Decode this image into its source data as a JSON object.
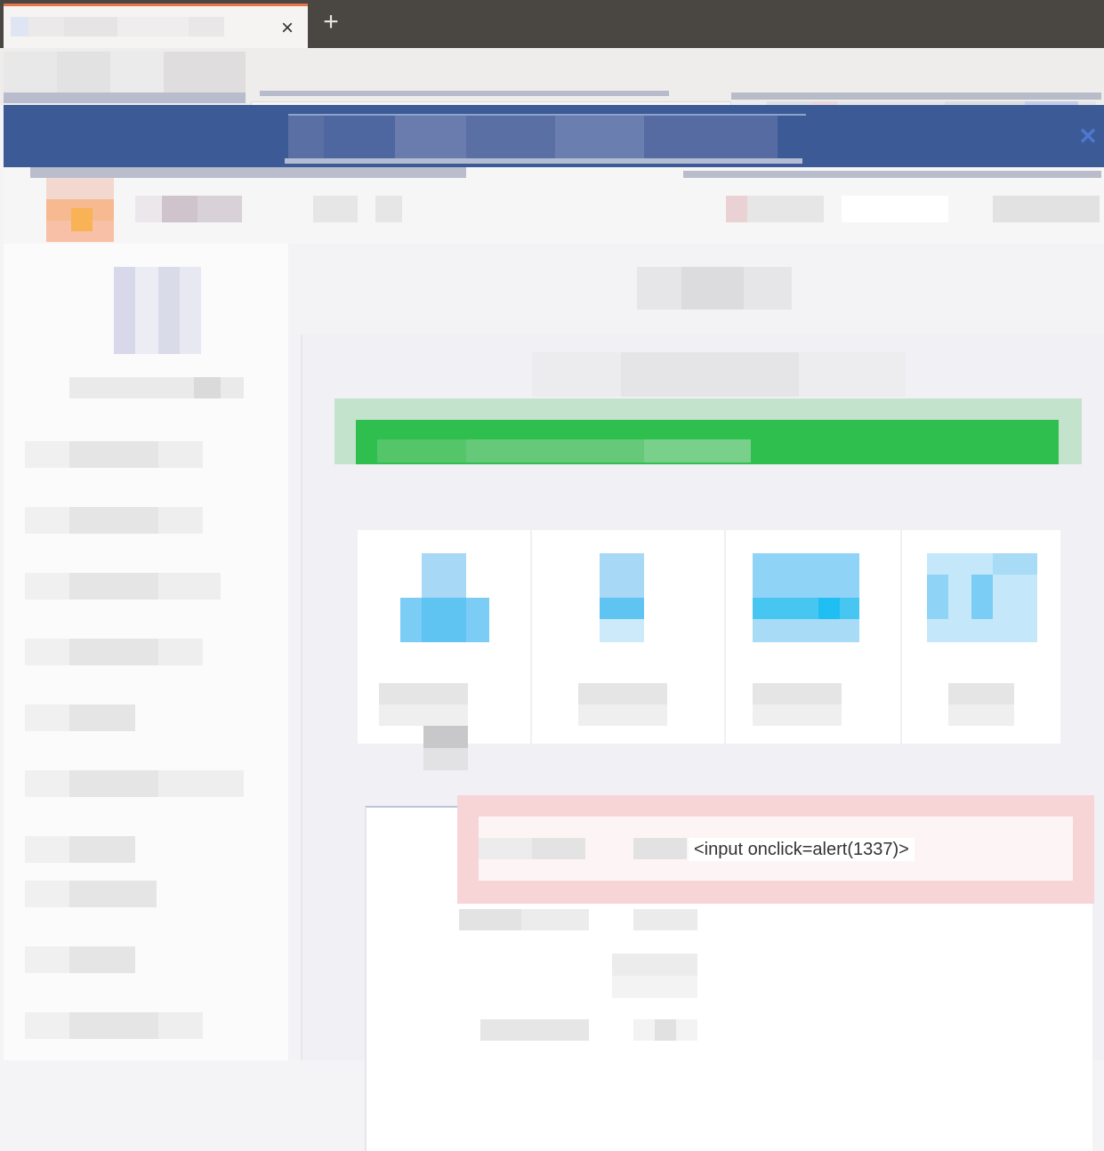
{
  "browser": {
    "tab_close_glyph": "×",
    "new_tab_glyph": "+",
    "url_first_char": "(",
    "menu_glyph": "⋮"
  },
  "banner": {
    "close_glyph": "✕"
  },
  "details": {
    "injected_value": "<input onclick=alert(1337)>"
  },
  "colors": {
    "banner": "#3c5a95",
    "alert_green": "#2ebf4f",
    "highlight_red": "#f7d5d7",
    "icon_blue": "#5fc4f1"
  }
}
